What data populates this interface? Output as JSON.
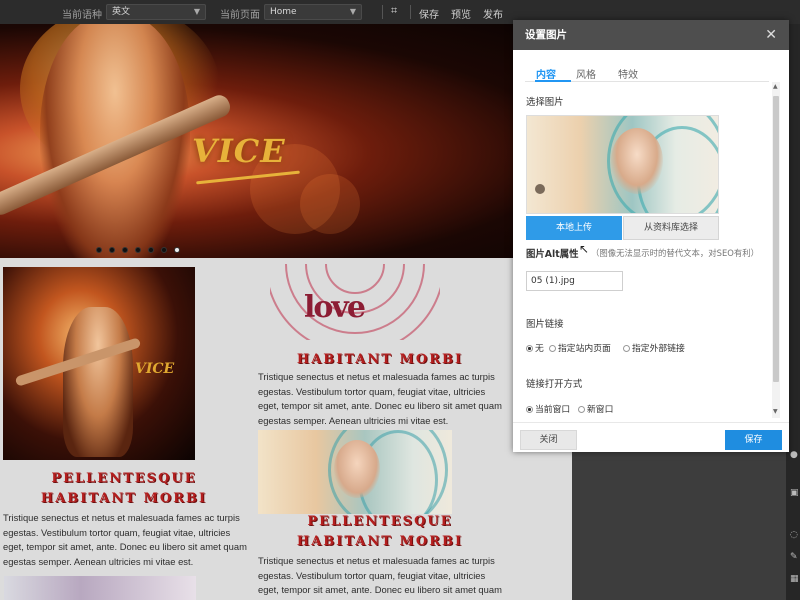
{
  "toolbar": {
    "language_label": "当前语种",
    "language_value": "英文",
    "page_label": "当前页面",
    "page_value": "Home",
    "save": "保存",
    "preview": "预览",
    "publish": "发布"
  },
  "banner": {
    "logo_text": "VICE",
    "slide_count": 7,
    "active_slide": 7
  },
  "articles": [
    {
      "heading_line1": "PELLENTESQUE",
      "heading_line2": "HABITANT MORBI",
      "text": "Tristique senectus et netus et malesuada fames ac turpis egestas. Vestibulum tortor quam, feugiat vitae, ultricies eget, tempor sit amet, ante. Donec eu libero sit amet quam egestas semper. Aenean ultricies mi vitae est."
    },
    {
      "logo_text": "love",
      "heading_line1": "HABITANT MORBI",
      "text": "Tristique senectus et netus et malesuada fames ac turpis egestas. Vestibulum tortor quam, feugiat vitae, ultricies eget, tempor sit amet, ante. Donec eu libero sit amet quam egestas semper. Aenean ultricies mi vitae est."
    },
    {
      "heading_line1": "PELLENTESQUE",
      "heading_line2": "HABITANT MORBI",
      "text": "Tristique senectus et netus et malesuada fames ac turpis egestas. Vestibulum tortor quam, feugiat vitae, ultricies eget, tempor sit amet, ante. Donec eu libero sit amet quam egestas semper."
    }
  ],
  "modal": {
    "title": "设置图片",
    "tabs": [
      "内容",
      "风格",
      "特效"
    ],
    "select_image_label": "选择图片",
    "upload_button": "本地上传",
    "library_button": "从资料库选择",
    "alt_title": "图片Alt属性",
    "alt_hint": "（图像无法显示时的替代文本，对SEO有利）",
    "alt_value": "05 (1).jpg",
    "link_label": "图片链接",
    "link_options": [
      "无",
      "指定站内页面",
      "指定外部链接"
    ],
    "link_selected": 0,
    "open_label": "链接打开方式",
    "open_options": [
      "当前窗口",
      "新窗口"
    ],
    "open_selected": 0,
    "close_button": "关闭",
    "save_button": "保存"
  },
  "colors": {
    "accent": "#2196f3",
    "heading_red": "#b41e1e",
    "toolbar_bg": "#2c2c2c",
    "modal_header": "#4e4e4e"
  },
  "icons": [
    "crop-icon",
    "close-icon",
    "cursor-icon",
    "user-icon",
    "trash-icon",
    "chat-icon",
    "edit-icon",
    "grid-icon"
  ]
}
